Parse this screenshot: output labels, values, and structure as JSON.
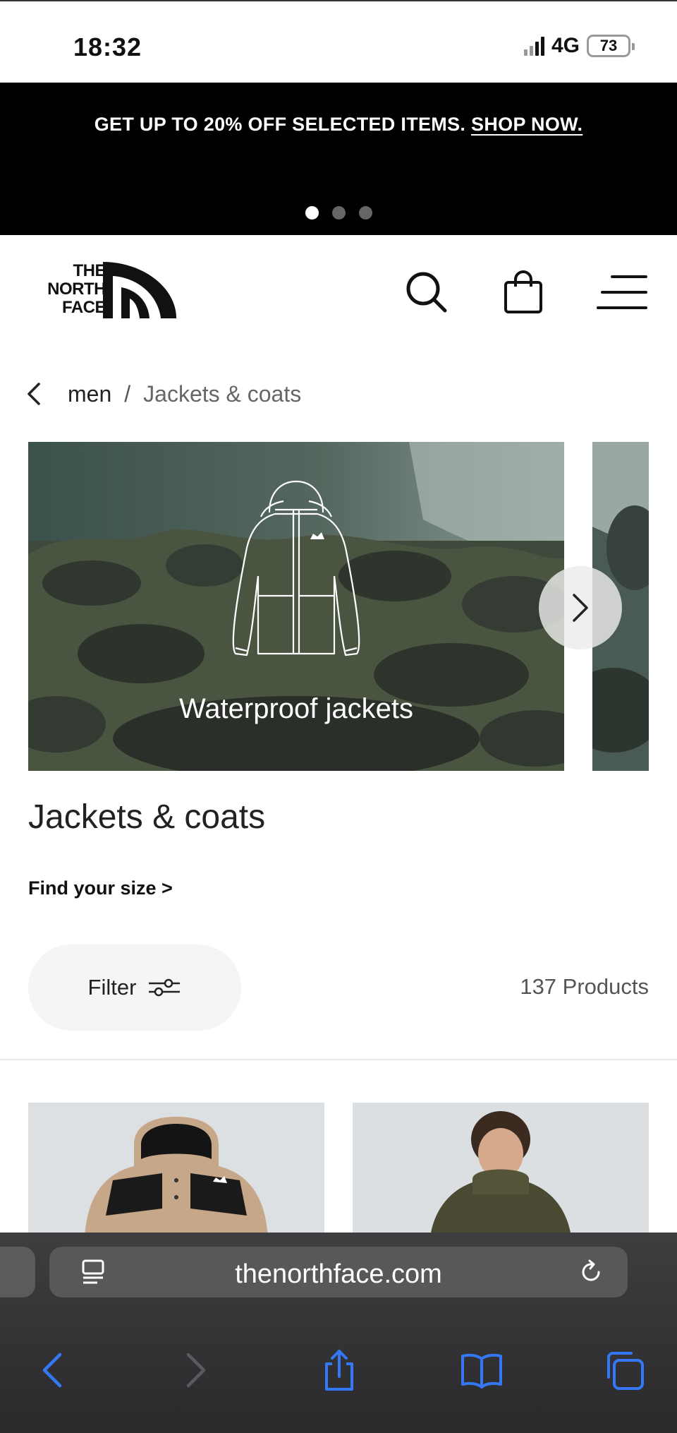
{
  "status_bar": {
    "time": "18:32",
    "network": "4G",
    "battery": "73"
  },
  "promo": {
    "text": "GET UP TO 20% OFF SELECTED ITEMS.",
    "link": "SHOP NOW.",
    "slides": 3,
    "active_slide": 1
  },
  "header": {
    "logo": {
      "line1": "THE",
      "line2": "NORTH",
      "line3": "FACE"
    },
    "icons": [
      "search-icon",
      "shopping-bag-icon",
      "menu-icon"
    ]
  },
  "breadcrumb": {
    "parent": "men",
    "separator": "/",
    "current": "Jackets & coats"
  },
  "carousel": {
    "cards": [
      {
        "caption": "Waterproof jackets"
      }
    ],
    "next_icon": "chevron-right-icon"
  },
  "page": {
    "title": "Jackets & coats",
    "size_link": "Find your size >",
    "filter_label": "Filter",
    "product_count": "137 Products"
  },
  "browser": {
    "url": "thenorthface.com",
    "toolbar": [
      "back-icon",
      "forward-icon",
      "share-icon",
      "bookmarks-icon",
      "tabs-icon"
    ]
  },
  "colors": {
    "promo_bg": "#000000",
    "ios_blue": "#3478f6",
    "browser_bg": "#2c2c2e"
  }
}
